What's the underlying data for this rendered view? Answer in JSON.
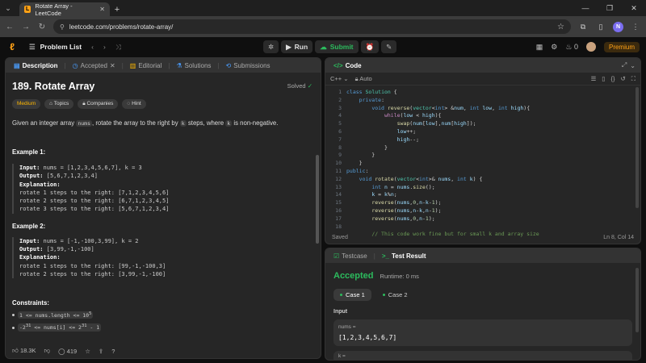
{
  "browser": {
    "tab_title": "Rotate Array - LeetCode",
    "url": "leetcode.com/problems/rotate-array/",
    "profile_initial": "N"
  },
  "lcnav": {
    "problem_list": "Problem List",
    "run": "Run",
    "submit": "Submit",
    "streak": "0",
    "premium": "Premium"
  },
  "desc_tabs": {
    "description": "Description",
    "accepted": "Accepted",
    "editorial": "Editorial",
    "solutions": "Solutions",
    "submissions": "Submissions"
  },
  "problem": {
    "title": "189. Rotate Array",
    "status": "Solved",
    "difficulty": "Medium",
    "chip_topics": "Topics",
    "chip_companies": "Companies",
    "chip_hint": "Hint",
    "stmt_1": "Given an integer array",
    "stmt_code1": "nums",
    "stmt_2": ", rotate the array to the right by",
    "stmt_code2": "k",
    "stmt_3": "steps, where",
    "stmt_code3": "k",
    "stmt_4": "is non-negative.",
    "ex1_title": "Example 1:",
    "ex1_input_label": "Input:",
    "ex1_input": "nums = [1,2,3,4,5,6,7], k = 3",
    "ex1_output_label": "Output:",
    "ex1_output": "[5,6,7,1,2,3,4]",
    "ex1_expl_label": "Explanation:",
    "ex1_expl_1": "rotate 1 steps to the right: [7,1,2,3,4,5,6]",
    "ex1_expl_2": "rotate 2 steps to the right: [6,7,1,2,3,4,5]",
    "ex1_expl_3": "rotate 3 steps to the right: [5,6,7,1,2,3,4]",
    "ex2_title": "Example 2:",
    "ex2_input_label": "Input:",
    "ex2_input": "nums = [-1,-100,3,99], k = 2",
    "ex2_output_label": "Output:",
    "ex2_output": "[3,99,-1,-100]",
    "ex2_expl_label": "Explanation:",
    "ex2_expl_1": "rotate 1 steps to the right: [99,-1,-100,3]",
    "ex2_expl_2": "rotate 2 steps to the right: [3,99,-1,-100]",
    "constraints_title": "Constraints:",
    "c1": "1 <= nums.length <= 10",
    "c1_sup": "5",
    "c2_a": "-2",
    "c2_sup1": "31",
    "c2_b": " <= nums[i] <= 2",
    "c2_sup2": "31",
    "c2_c": " - 1"
  },
  "desc_footer": {
    "likes": "18.3K",
    "comments": "419"
  },
  "code_panel": {
    "title": "Code",
    "language": "C++",
    "mode": "Auto",
    "saved": "Saved",
    "cursor": "Ln 8, Col 14",
    "line_numbers": [
      "1",
      "2",
      "3",
      "4",
      "5",
      "6",
      "7",
      "8",
      "9",
      "10",
      "11",
      "12",
      "13",
      "14",
      "15",
      "16",
      "17",
      "18"
    ]
  },
  "result_panel": {
    "tab_testcase": "Testcase",
    "tab_result": "Test Result",
    "verdict": "Accepted",
    "runtime": "Runtime: 0 ms",
    "case1": "Case 1",
    "case2": "Case 2",
    "input_label": "Input",
    "var1_name": "nums =",
    "var1_value": "[1,2,3,4,5,6,7]",
    "var2_name": "k ="
  }
}
